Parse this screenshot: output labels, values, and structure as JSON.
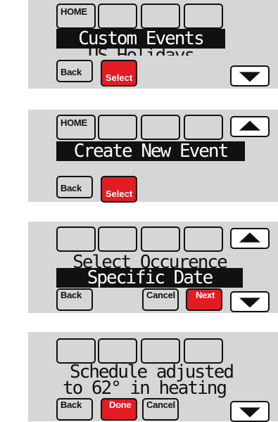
{
  "screens": [
    {
      "home_label": "HOME",
      "lines": [
        "Custom Events",
        "US Holidays"
      ],
      "back_label": "Back",
      "select_label": "Select",
      "down_icon": "down-arrow-icon"
    },
    {
      "home_label": "HOME",
      "lines": [
        "Create New Event"
      ],
      "back_label": "Back",
      "select_label": "Select",
      "up_icon": "up-arrow-icon"
    },
    {
      "lines": [
        "Select Occurence",
        "Specific Date"
      ],
      "back_label": "Back",
      "cancel_label": "Cancel",
      "next_label": "Next",
      "up_icon": "up-arrow-icon",
      "down_icon": "down-arrow-icon"
    },
    {
      "lines": [
        "Schedule adjusted",
        "to 62° in heating"
      ],
      "back_label": "Back",
      "done_label": "Done",
      "cancel_label": "Cancel",
      "down_icon": "down-arrow-icon"
    }
  ],
  "colors": {
    "panel": "#d6d6d6",
    "accent": "#e31b23",
    "ink": "#111111"
  }
}
